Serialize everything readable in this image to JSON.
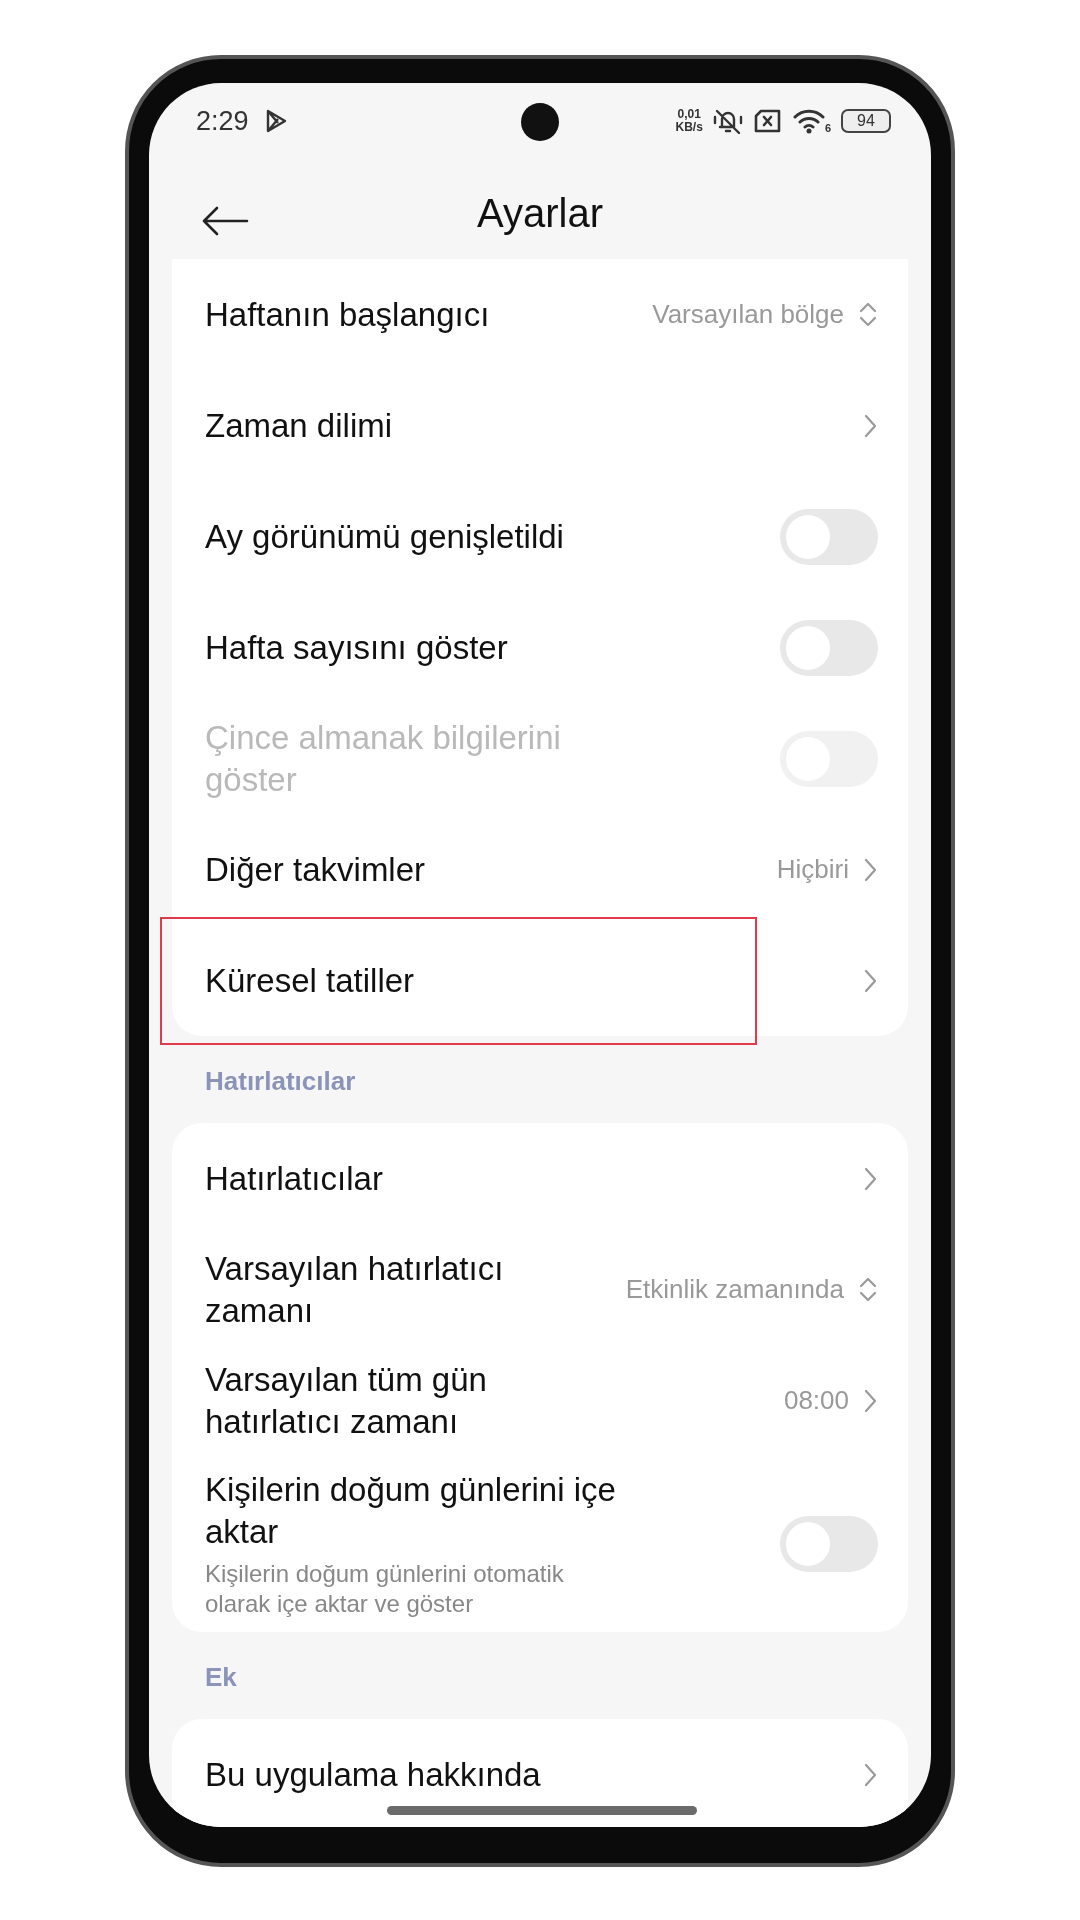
{
  "status_bar": {
    "time": "2:29",
    "data_speed_value": "0,01",
    "data_speed_unit": "KB/s",
    "wifi_label": "6",
    "battery": "94"
  },
  "header": {
    "title": "Ayarlar"
  },
  "sections": [
    {
      "rows": [
        {
          "kind": "spinner",
          "label": "Haftanın başlangıcı",
          "value": "Varsayılan bölge",
          "disabled": false,
          "highlighted": false
        },
        {
          "kind": "chevron",
          "label": "Zaman dilimi",
          "disabled": false,
          "highlighted": false
        },
        {
          "kind": "toggle",
          "label": "Ay görünümü genişletildi",
          "on": false,
          "disabled": false,
          "highlighted": false
        },
        {
          "kind": "toggle",
          "label": "Hafta sayısını göster",
          "on": false,
          "disabled": false,
          "highlighted": false
        },
        {
          "kind": "toggle",
          "label": "Çince almanak bilgilerini göster",
          "on": false,
          "disabled": true,
          "highlighted": false
        },
        {
          "kind": "chevron",
          "label": "Diğer takvimler",
          "value": "Hiçbiri",
          "disabled": false,
          "highlighted": false
        },
        {
          "kind": "chevron",
          "label": "Küresel tatiller",
          "disabled": false,
          "highlighted": true
        }
      ]
    },
    {
      "title": "Hatırlatıcılar",
      "rows": [
        {
          "kind": "chevron",
          "label": "Hatırlatıcılar",
          "disabled": false,
          "highlighted": false
        },
        {
          "kind": "spinner",
          "label": "Varsayılan hatırlatıcı zamanı",
          "value": "Etkinlik zamanında",
          "disabled": false,
          "highlighted": false
        },
        {
          "kind": "chevron",
          "label": "Varsayılan tüm gün hatırlatıcı zamanı",
          "value": "08:00",
          "disabled": false,
          "highlighted": false
        },
        {
          "kind": "toggle",
          "label": "Kişilerin doğum günlerini içe aktar",
          "subtitle": "Kişilerin doğum günlerini otomatik olarak içe aktar ve göster",
          "on": false,
          "disabled": false,
          "highlighted": false
        }
      ]
    },
    {
      "title": "Ek",
      "rows": [
        {
          "kind": "chevron",
          "label": "Bu uygulama hakkında",
          "disabled": false,
          "highlighted": false
        }
      ]
    }
  ]
}
